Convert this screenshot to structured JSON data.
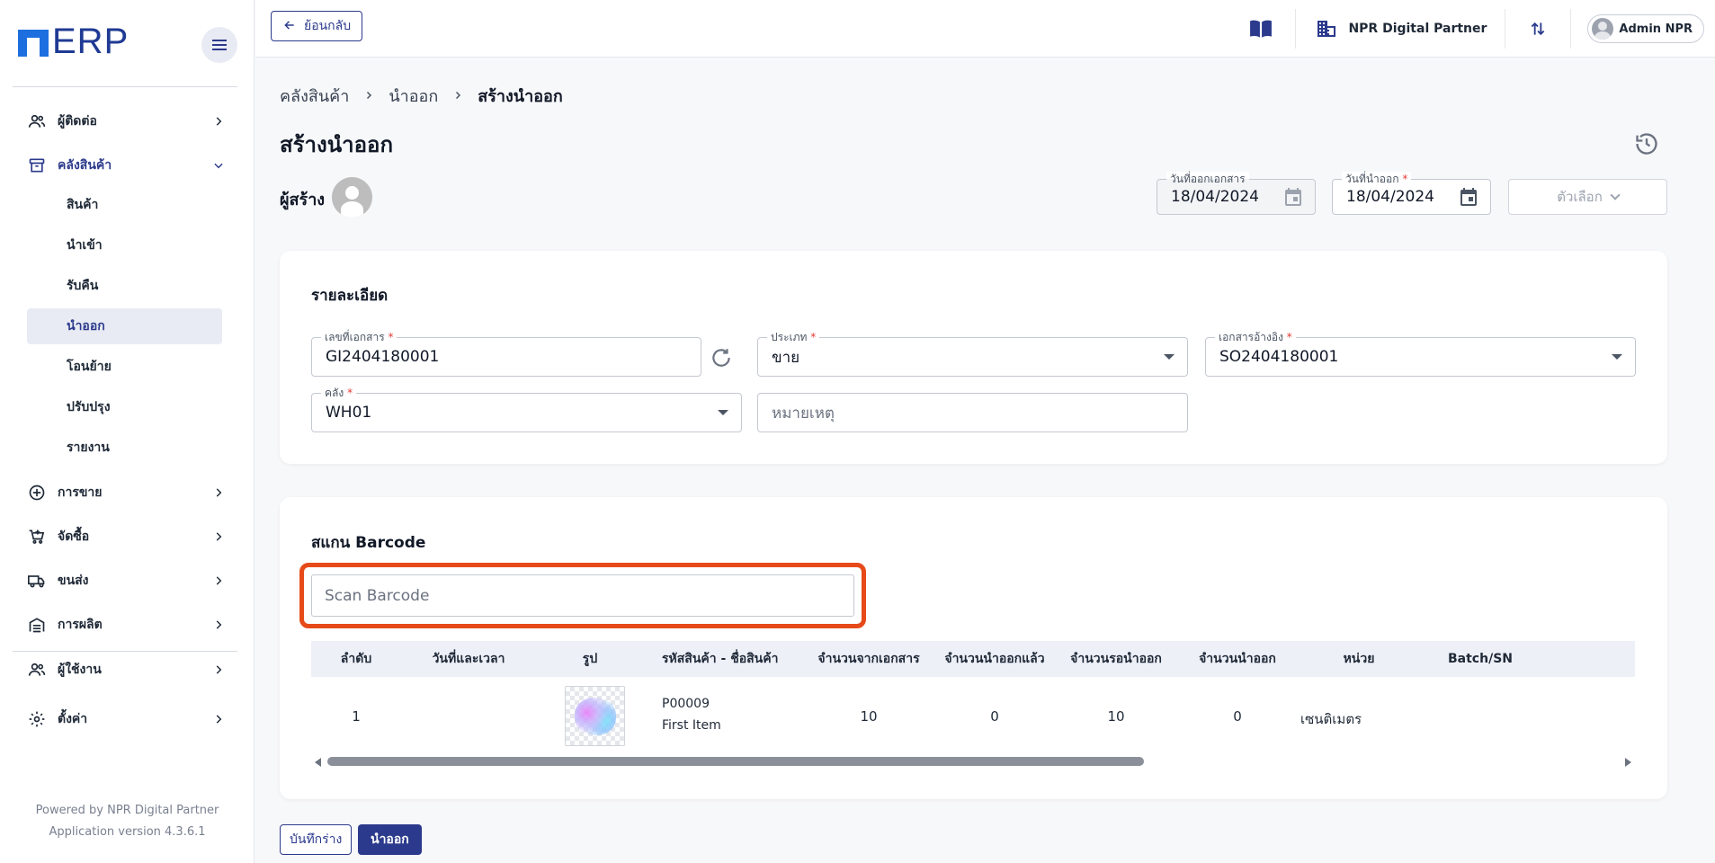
{
  "app": {
    "logo_text": "ERP"
  },
  "topbar": {
    "back_label": "ย้อนกลับ",
    "company_name": "NPR Digital Partner",
    "user_name": "Admin NPR"
  },
  "sidebar": {
    "items": [
      {
        "label": "ผู้ติดต่อ",
        "icon": "contacts-icon"
      },
      {
        "label": "คลังสินค้า",
        "icon": "warehouse-icon"
      },
      {
        "label": "การขาย",
        "icon": "plus-circle-icon"
      },
      {
        "label": "จัดซื้อ",
        "icon": "cart-icon"
      },
      {
        "label": "ขนส่ง",
        "icon": "truck-icon"
      },
      {
        "label": "การผลิต",
        "icon": "factory-icon"
      },
      {
        "label": "ผู้ใช้งาน",
        "icon": "users-icon"
      },
      {
        "label": "ตั้งค่า",
        "icon": "gear-icon"
      }
    ],
    "warehouse_sub": [
      "สินค้า",
      "นำเข้า",
      "รับคืน",
      "นำออก",
      "โอนย้าย",
      "ปรับปรุง",
      "รายงาน"
    ],
    "footer_powered": "Powered by NPR Digital Partner",
    "footer_version": "Application version 4.3.6.1"
  },
  "breadcrumb": [
    "คลังสินค้า",
    "นำออก",
    "สร้างนำออก"
  ],
  "page": {
    "title": "สร้างนำออก",
    "creator_label": "ผู้สร้าง",
    "doc_date_label": "วันที่ออกเอกสาร",
    "doc_date": "18/04/2024",
    "issue_date_label": "วันที่นำออก",
    "issue_date": "18/04/2024",
    "options_label": "ตัวเลือก"
  },
  "details": {
    "title": "รายละเอียด",
    "doc_no_label": "เลขที่เอกสาร",
    "doc_no": "GI2404180001",
    "type_label": "ประเภท",
    "type_value": "ขาย",
    "ref_label": "เอกสารอ้างอิง",
    "ref_value": "SO2404180001",
    "warehouse_label": "คลัง",
    "warehouse_value": "WH01",
    "remark_placeholder": "หมายเหตุ"
  },
  "scan": {
    "title": "สแกน Barcode",
    "placeholder": "Scan Barcode"
  },
  "table": {
    "headers": [
      "ลำดับ",
      "วันที่และเวลา",
      "รูป",
      "รหัสสินค้า - ชื่อสินค้า",
      "จำนวนจากเอกสาร",
      "จำนวนนำออกแล้ว",
      "จำนวนรอนำออก",
      "จำนวนนำออก",
      "หน่วย",
      "Batch/SN"
    ],
    "rows": [
      {
        "no": "1",
        "datetime": "",
        "code": "P00009",
        "name": "First Item",
        "doc_qty": "10",
        "issued_qty": "0",
        "pending_qty": "10",
        "issue_qty": "0",
        "unit": "เซนติเมตร",
        "batch": ""
      }
    ]
  },
  "actions": {
    "draft_label": "บันทึกร่าง",
    "issue_label": "นำออก"
  }
}
